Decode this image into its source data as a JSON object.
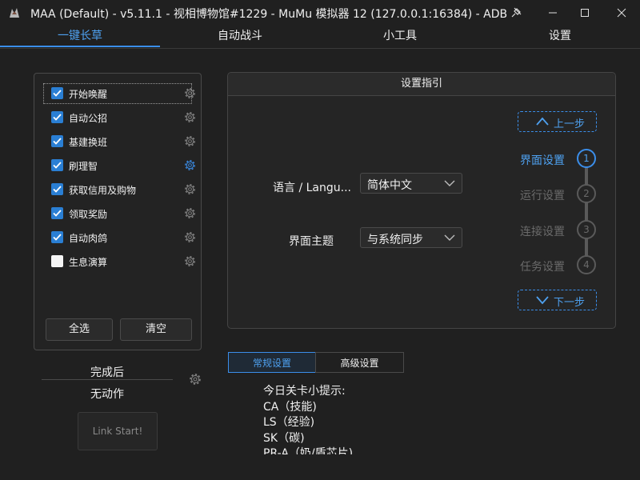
{
  "window": {
    "title": "MAA (Default) - v5.11.1 - 视相博物馆#1229 - MuMu 模拟器 12 (127.0.0.1:16384) - ADB",
    "controls": [
      "pin-icon",
      "minimize-icon",
      "maximize-icon",
      "close-icon"
    ]
  },
  "nav": {
    "tabs": [
      {
        "label": "一键长草",
        "active": true
      },
      {
        "label": "自动战斗",
        "active": false
      },
      {
        "label": "小工具",
        "active": false
      },
      {
        "label": "设置",
        "active": false
      }
    ]
  },
  "tasks": {
    "items": [
      {
        "label": "开始唤醒",
        "checked": true
      },
      {
        "label": "自动公招",
        "checked": true
      },
      {
        "label": "基建换班",
        "checked": true
      },
      {
        "label": "刷理智",
        "checked": true
      },
      {
        "label": "获取信用及购物",
        "checked": true
      },
      {
        "label": "领取奖励",
        "checked": true
      },
      {
        "label": "自动肉鸽",
        "checked": true
      },
      {
        "label": "生息演算",
        "checked": false
      }
    ],
    "select_all_label": "全选",
    "clear_label": "清空"
  },
  "after_completion": {
    "label": "完成后",
    "value": "无动作"
  },
  "link_start_label": "Link Start!",
  "guide": {
    "header": "设置指引",
    "language_label": "语言 / Langu...",
    "language_value": "简体中文",
    "theme_label": "界面主题",
    "theme_value": "与系统同步",
    "prev_label": "上一步",
    "next_label": "下一步",
    "steps": [
      {
        "label": "界面设置",
        "number": "1",
        "active": true
      },
      {
        "label": "运行设置",
        "number": "2",
        "active": false
      },
      {
        "label": "连接设置",
        "number": "3",
        "active": false
      },
      {
        "label": "任务设置",
        "number": "4",
        "active": false
      }
    ]
  },
  "settings_tabs": {
    "normal": "常规设置",
    "advanced": "高级设置"
  },
  "tips": {
    "title": "今日关卡小提示:",
    "lines": [
      "CA（技能)",
      "LS（经验)",
      "SK（碳)",
      "PR-A（奶/盾芯片)"
    ]
  },
  "colors": {
    "accent": "#3b8eea",
    "background": "#202020",
    "checkbox": "#2a7fd4",
    "inactive_step": "#6a6a6a"
  }
}
